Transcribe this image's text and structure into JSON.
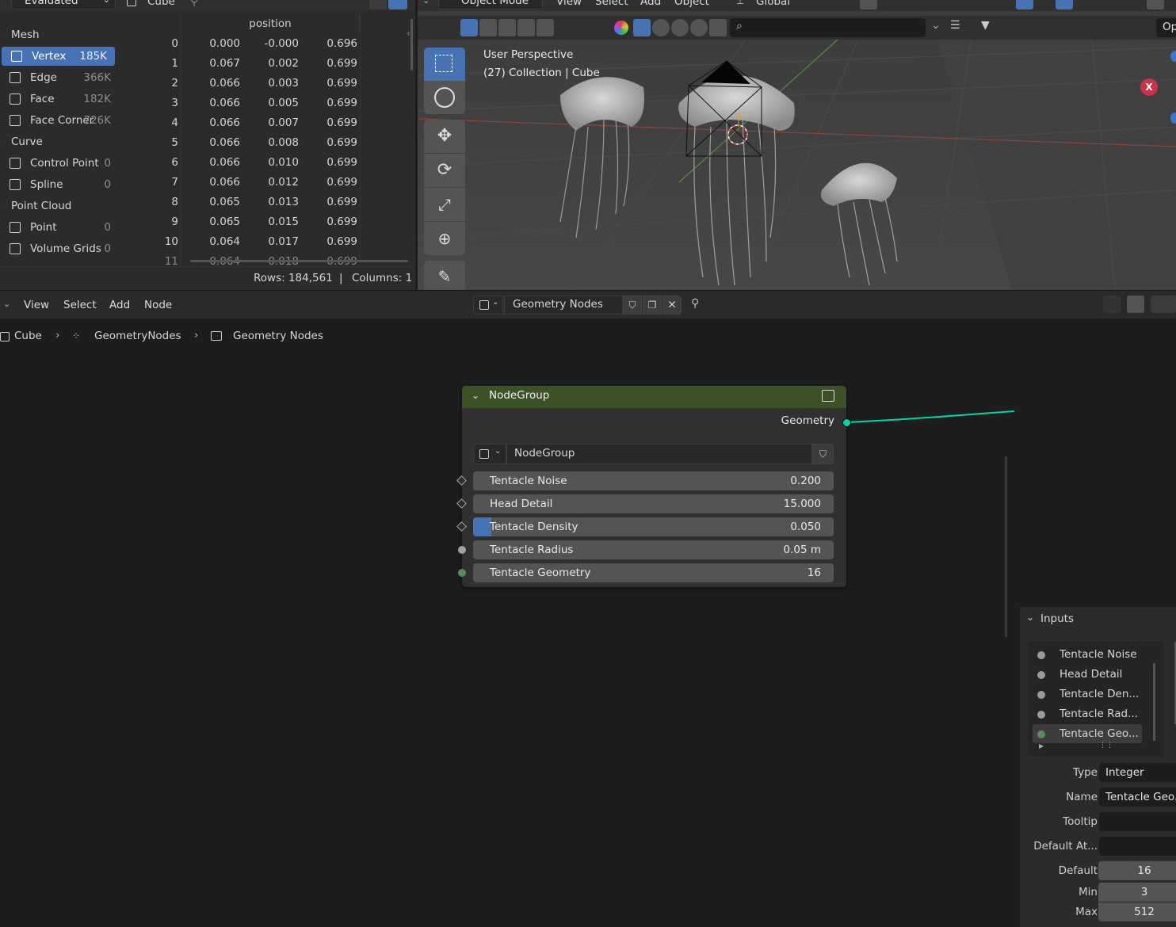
{
  "spreadsheet": {
    "display_mode": "Evaluated",
    "object_name": "Cube",
    "column_header": "position",
    "domains": [
      {
        "label": "Mesh",
        "type": "category"
      },
      {
        "label": "Vertex",
        "count": "185K",
        "selected": true
      },
      {
        "label": "Edge",
        "count": "366K"
      },
      {
        "label": "Face",
        "count": "182K"
      },
      {
        "label": "Face Corner",
        "count": "726K"
      },
      {
        "label": "Curve",
        "type": "category"
      },
      {
        "label": "Control Point",
        "count": "0"
      },
      {
        "label": "Spline",
        "count": "0"
      },
      {
        "label": "Point Cloud",
        "type": "category"
      },
      {
        "label": "Point",
        "count": "0"
      },
      {
        "label": "Volume Grids",
        "count": "0"
      }
    ],
    "rows": [
      [
        "0",
        "0.000",
        "-0.000",
        "0.696"
      ],
      [
        "1",
        "0.067",
        "0.002",
        "0.699"
      ],
      [
        "2",
        "0.066",
        "0.003",
        "0.699"
      ],
      [
        "3",
        "0.066",
        "0.005",
        "0.699"
      ],
      [
        "4",
        "0.066",
        "0.007",
        "0.699"
      ],
      [
        "5",
        "0.066",
        "0.008",
        "0.699"
      ],
      [
        "6",
        "0.066",
        "0.010",
        "0.699"
      ],
      [
        "7",
        "0.066",
        "0.012",
        "0.699"
      ],
      [
        "8",
        "0.065",
        "0.013",
        "0.699"
      ],
      [
        "9",
        "0.065",
        "0.015",
        "0.699"
      ],
      [
        "10",
        "0.064",
        "0.017",
        "0.699"
      ],
      [
        "11",
        "0.064",
        "0.018",
        "0.699"
      ]
    ],
    "rows_label": "Rows: 184,561",
    "separator": "|",
    "columns_label": "Columns: 1"
  },
  "viewport": {
    "mode": "Object Mode",
    "menus": [
      "View",
      "Select",
      "Add",
      "Object"
    ],
    "orientation": "Global",
    "overlay_line1": "User Perspective",
    "overlay_line2": "(27) Collection | Cube",
    "options_label": "Op",
    "gizmo_x": "X"
  },
  "node_editor": {
    "menus": [
      "View",
      "Select",
      "Add",
      "Node"
    ],
    "tree_name": "Geometry Nodes",
    "breadcrumb": [
      "Cube",
      "GeometryNodes",
      "Geometry Nodes"
    ],
    "node": {
      "title": "NodeGroup",
      "output": "Geometry",
      "group_name": "NodeGroup",
      "inputs": [
        {
          "label": "Tentacle Noise",
          "value": "0.200",
          "socket": "diamond"
        },
        {
          "label": "Head Detail",
          "value": "15.000",
          "socket": "diamond"
        },
        {
          "label": "Tentacle Density",
          "value": "0.050",
          "socket": "diamond",
          "fill": 0.05
        },
        {
          "label": "Tentacle Radius",
          "value": "0.05 m",
          "socket": "circle-grey"
        },
        {
          "label": "Tentacle Geometry",
          "value": "16",
          "socket": "circle-green"
        }
      ]
    }
  },
  "inputs_panel": {
    "title": "Inputs",
    "items": [
      "Tentacle Noise",
      "Head Detail",
      "Tentacle Den...",
      "Tentacle Rad...",
      "Tentacle Geo..."
    ],
    "properties": {
      "type_label": "Type",
      "type_value": "Integer",
      "name_label": "Name",
      "name_value": "Tentacle Geo...",
      "tooltip_label": "Tooltip",
      "tooltip_value": "",
      "default_attr_label": "Default At...",
      "default_attr_value": "",
      "default_label": "Default",
      "default_value": "16",
      "min_label": "Min",
      "min_value": "3",
      "max_label": "Max",
      "max_value": "512"
    }
  },
  "colors": {
    "selection": "#4772b3",
    "node_header": "#3d5127",
    "geometry_socket": "#00d6a3",
    "integer_socket": "#598c5c"
  }
}
